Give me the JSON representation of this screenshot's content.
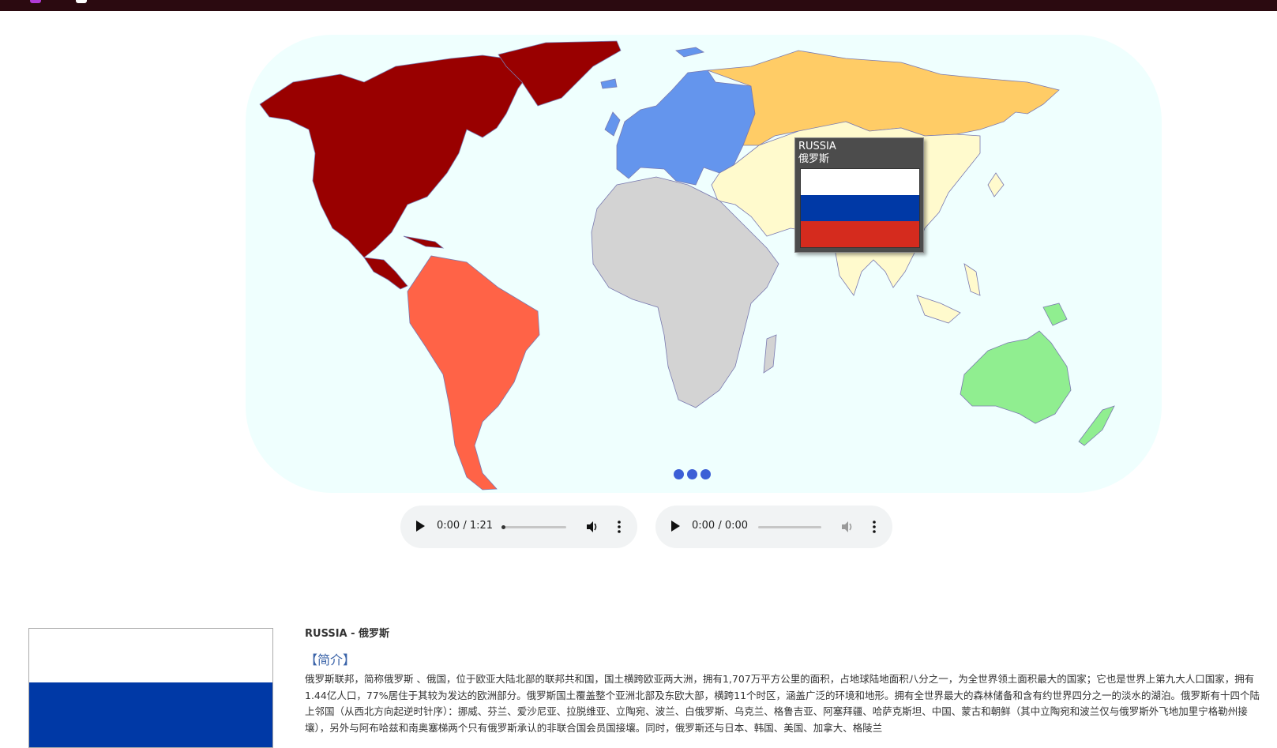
{
  "country": {
    "name_en": "RUSSIA",
    "name_local": "俄罗斯",
    "header": "RUSSIA - 俄罗斯",
    "flag_colors": [
      "#ffffff",
      "#0039a6",
      "#d52b1e"
    ]
  },
  "map": {
    "ocean_color": "#effffe",
    "regions": [
      {
        "name": "North America",
        "color": "#990000"
      },
      {
        "name": "South America",
        "color": "#ff6347"
      },
      {
        "name": "Europe",
        "color": "#6495ed"
      },
      {
        "name": "Russia",
        "color": "#ffcc66"
      },
      {
        "name": "Asia",
        "color": "#fffacd"
      },
      {
        "name": "Africa",
        "color": "#d3d3d3"
      },
      {
        "name": "Oceania",
        "color": "#90ee90"
      }
    ],
    "carousel_dots": 3
  },
  "audio": [
    {
      "time": "0:00 / 1:21",
      "progress": 0.02,
      "muted": false
    },
    {
      "time": "0:00 / 0:00",
      "progress": 0,
      "muted": true
    }
  ],
  "info": {
    "section_title": "【简介】",
    "description": "俄罗斯联邦，简称俄罗斯 、俄国，位于欧亚大陆北部的联邦共和国，国土横跨欧亚两大洲，拥有1,707万平方公里的面积，占地球陆地面积八分之一，为全世界领土面积最大的国家；它也是世界上第九大人口国家，拥有1.44亿人口，77%居住于其较为发达的欧洲部分。俄罗斯国土覆盖整个亚洲北部及东欧大部，横跨11个时区，涵盖广泛的环境和地形。拥有全世界最大的森林储备和含有约世界四分之一的淡水的湖泊。俄罗斯有十四个陆上邻国（从西北方向起逆时针序）：挪威、芬兰、爱沙尼亚、拉脱维亚、立陶宛、波兰、白俄罗斯、乌克兰、格鲁吉亚、阿塞拜疆、哈萨克斯坦、中国、蒙古和朝鲜（其中立陶宛和波兰仅与俄罗斯外飞地加里宁格勒州接壤），另外与阿布哈兹和南奥塞梯两个只有俄罗斯承认的非联合国会员国接壤。同时，俄罗斯还与日本、韩国、美国、加拿大、格陵兰"
  }
}
